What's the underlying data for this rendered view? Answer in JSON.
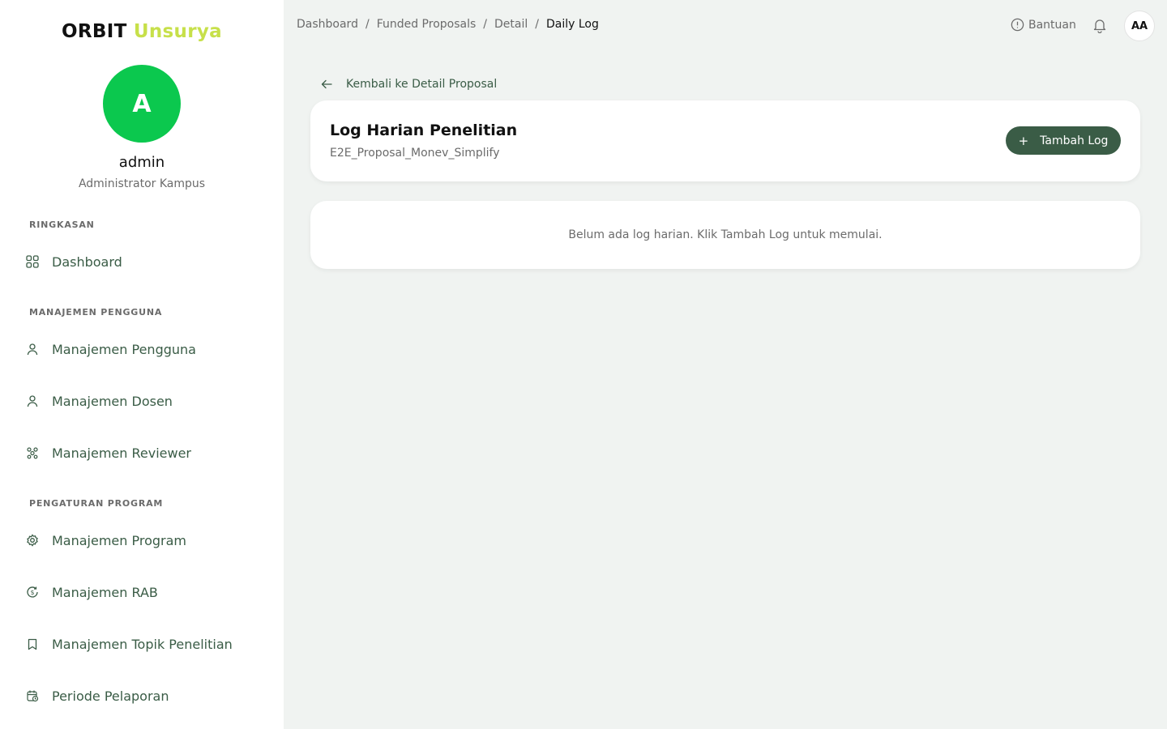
{
  "brand": {
    "part1": "ORBIT",
    "part2": "Unsurya"
  },
  "user": {
    "initial": "A",
    "name": "admin",
    "role": "Administrator Kampus",
    "avatar_initials": "AA"
  },
  "sidebar": {
    "sections": [
      {
        "title": "RINGKASAN",
        "items": [
          {
            "label": "Dashboard",
            "icon": "grid-icon"
          }
        ]
      },
      {
        "title": "MANAJEMEN PENGGUNA",
        "items": [
          {
            "label": "Manajemen Pengguna",
            "icon": "user-icon"
          },
          {
            "label": "Manajemen Dosen",
            "icon": "user-icon"
          },
          {
            "label": "Manajemen Reviewer",
            "icon": "users-network-icon"
          }
        ]
      },
      {
        "title": "PENGATURAN PROGRAM",
        "items": [
          {
            "label": "Manajemen Program",
            "icon": "gear-icon"
          },
          {
            "label": "Manajemen RAB",
            "icon": "dollar-cycle-icon"
          },
          {
            "label": "Manajemen Topik Penelitian",
            "icon": "bookmark-icon"
          },
          {
            "label": "Periode Pelaporan",
            "icon": "calendar-clock-icon"
          }
        ]
      }
    ]
  },
  "breadcrumb": [
    "Dashboard",
    "Funded Proposals",
    "Detail",
    "Daily Log"
  ],
  "header": {
    "help_label": "Bantuan"
  },
  "back_link": "Kembali ke Detail Proposal",
  "log_card": {
    "title": "Log Harian Penelitian",
    "subtitle": "E2E_Proposal_Monev_Simplify",
    "add_button": "Tambah Log"
  },
  "empty_state": "Belum ada log harian. Klik Tambah Log untuk memulai.",
  "colors": {
    "brand_accent": "#c7e04a",
    "primary": "#3a5c46",
    "avatar_bg": "#0bc84e",
    "page_bg": "#f0f3f1"
  }
}
